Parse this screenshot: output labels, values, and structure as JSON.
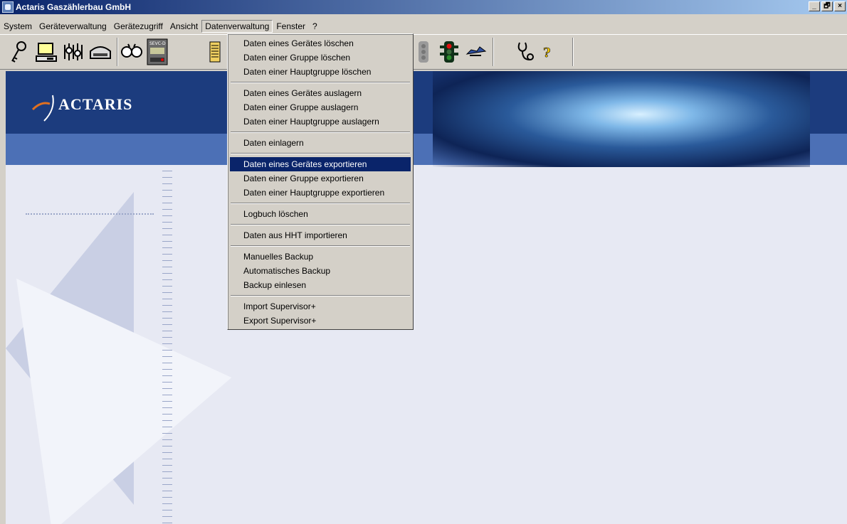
{
  "window": {
    "title": "Actaris Gaszählerbau GmbH",
    "minimize": "_",
    "restore": "🗗",
    "close": "×"
  },
  "menubar": {
    "items": [
      {
        "label": "System"
      },
      {
        "label": "Geräteverwaltung"
      },
      {
        "label": "Gerätezugriff"
      },
      {
        "label": "Ansicht"
      },
      {
        "label": "Datenverwaltung"
      },
      {
        "label": "Fenster"
      },
      {
        "label": "?"
      }
    ]
  },
  "toolbar": {
    "icons": [
      "key-icon",
      "computer-icon",
      "hardware-icon",
      "modem-icon",
      "glasses-icon",
      "display-icon",
      "document-icon",
      "traffic-light-icon",
      "traffic-light-red-icon",
      "airplane-icon",
      "stethoscope-icon",
      "help-icon"
    ],
    "display_label": "SEVC-D"
  },
  "banner": {
    "logo": "ACTARIS"
  },
  "dropdown": {
    "items": [
      "Daten eines Gerätes löschen",
      "Daten einer Gruppe löschen",
      "Daten einer Hauptgruppe löschen",
      "Daten eines Gerätes auslagern",
      "Daten einer Gruppe auslagern",
      "Daten einer Hauptgruppe auslagern",
      "Daten einlagern",
      "Daten eines Gerätes exportieren",
      "Daten einer Gruppe exportieren",
      "Daten einer Hauptgruppe exportieren",
      "Logbuch löschen",
      "Daten aus HHT importieren",
      "Manuelles Backup",
      "Automatisches Backup",
      "Backup einlesen",
      "Import Supervisor+",
      "Export Supervisor+"
    ],
    "selected": "Daten eines Gerätes exportieren"
  },
  "colors": {
    "selection": "#0a246a",
    "banner": "#1c3c7e",
    "strip": "#4c70b6",
    "workspace": "#e7e9f3"
  }
}
